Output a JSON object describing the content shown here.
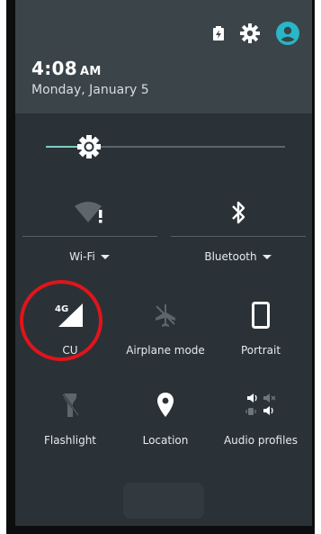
{
  "header": {
    "time": "4:08",
    "ampm": "AM",
    "date": "Monday, January 5"
  },
  "status_icons": [
    "battery-charging-icon",
    "gear-icon",
    "account-icon"
  ],
  "brightness": {
    "level": 0.18
  },
  "wide_tiles": [
    {
      "label": "Wi-Fi",
      "icon": "wifi-alert-icon"
    },
    {
      "label": "Bluetooth",
      "icon": "bluetooth-icon"
    }
  ],
  "tiles_row1": [
    {
      "label": "CU",
      "icon": "signal-4g-icon"
    },
    {
      "label": "Airplane mode",
      "icon": "airplane-icon"
    },
    {
      "label": "Portrait",
      "icon": "portrait-icon"
    }
  ],
  "tiles_row2": [
    {
      "label": "Flashlight",
      "icon": "flashlight-icon"
    },
    {
      "label": "Location",
      "icon": "location-pin-icon"
    },
    {
      "label": "Audio profiles",
      "icon": "audio-profiles-icon"
    }
  ],
  "signal_badge": "4G",
  "colors": {
    "accent": "#7fcbc4",
    "account": "#29b6c6",
    "highlight": "#e0141c",
    "panel": "#2a3237",
    "header": "#3b4449"
  }
}
